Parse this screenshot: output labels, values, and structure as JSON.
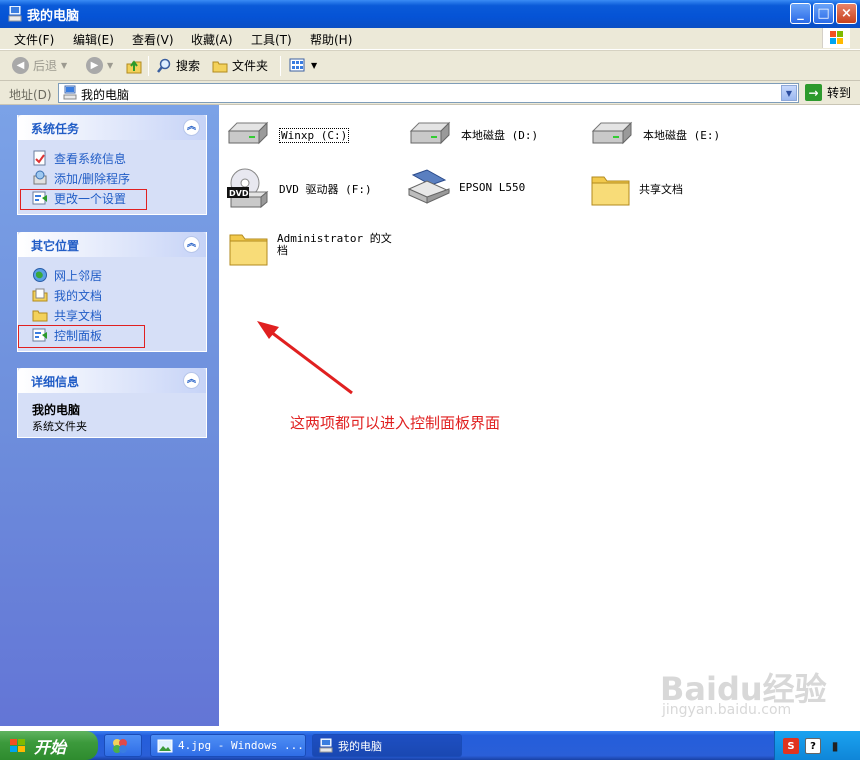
{
  "window": {
    "title": "我的电脑",
    "buttons": [
      "_",
      "□",
      "×"
    ]
  },
  "menubar": {
    "items": [
      "文件(F)",
      "编辑(E)",
      "查看(V)",
      "收藏(A)",
      "工具(T)",
      "帮助(H)"
    ]
  },
  "toolbar": {
    "back": "后退",
    "search": "搜索",
    "folders": "文件夹"
  },
  "addressbar": {
    "label": "地址(D)",
    "value": "我的电脑",
    "go": "转到"
  },
  "sidebar": {
    "system_tasks": {
      "title": "系统任务",
      "items": [
        {
          "label": "查看系统信息",
          "icon": "system-info-icon"
        },
        {
          "label": "添加/删除程序",
          "icon": "add-remove-icon"
        },
        {
          "label": "更改一个设置",
          "icon": "control-panel-icon"
        }
      ]
    },
    "other_places": {
      "title": "其它位置",
      "items": [
        {
          "label": "网上邻居",
          "icon": "network-icon"
        },
        {
          "label": "我的文档",
          "icon": "documents-icon"
        },
        {
          "label": "共享文档",
          "icon": "folder-icon"
        },
        {
          "label": "控制面板",
          "icon": "control-panel-icon"
        }
      ]
    },
    "details": {
      "title": "详细信息",
      "name": "我的电脑",
      "type": "系统文件夹"
    }
  },
  "content": {
    "items": [
      {
        "label": "Winxp (C:)",
        "icon": "hard-drive-icon"
      },
      {
        "label": "本地磁盘 (D:)",
        "icon": "hard-drive-icon"
      },
      {
        "label": "本地磁盘 (E:)",
        "icon": "hard-drive-icon"
      },
      {
        "label": "DVD 驱动器 (F:)",
        "icon": "dvd-drive-icon"
      },
      {
        "label": "EPSON L550",
        "icon": "scanner-icon"
      },
      {
        "label": "共享文档",
        "icon": "folder-icon"
      },
      {
        "label": "Administrator 的文档",
        "icon": "folder-icon"
      }
    ],
    "annotation": "这两项都可以进入控制面板界面"
  },
  "taskbar": {
    "start": "开始",
    "tasks": [
      {
        "label": "4.jpg - Windows ..."
      },
      {
        "label": "我的电脑"
      }
    ]
  },
  "watermark": {
    "brand": "Baidu经验",
    "url": "jingyan.baidu.com"
  },
  "colors": {
    "titlebar": "#0553d6",
    "sidebar_link": "#215dc6",
    "annotation": "#e02020"
  }
}
